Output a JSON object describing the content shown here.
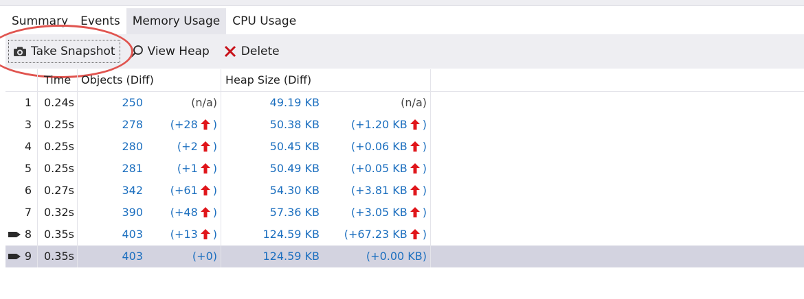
{
  "tabs": [
    "Summary",
    "Events",
    "Memory Usage",
    "CPU Usage"
  ],
  "toolbar": {
    "take_snapshot": "Take Snapshot",
    "view_heap": "View Heap",
    "delete": "Delete"
  },
  "columns": {
    "time": "Time",
    "objects": "Objects (Diff)",
    "heap": "Heap Size (Diff)"
  },
  "rows": [
    {
      "id": "1",
      "time": "0.24s",
      "objects": "250",
      "obj_diff": "(n/a)",
      "heap": "49.19 KB",
      "heap_diff": "(n/a)",
      "marker": false,
      "arrow": false
    },
    {
      "id": "3",
      "time": "0.25s",
      "objects": "278",
      "obj_diff": "(+28",
      "heap": "50.38 KB",
      "heap_diff": "(+1.20 KB",
      "marker": false,
      "arrow": true
    },
    {
      "id": "4",
      "time": "0.25s",
      "objects": "280",
      "obj_diff": "(+2",
      "heap": "50.45 KB",
      "heap_diff": "(+0.06 KB",
      "marker": false,
      "arrow": true
    },
    {
      "id": "5",
      "time": "0.25s",
      "objects": "281",
      "obj_diff": "(+1",
      "heap": "50.49 KB",
      "heap_diff": "(+0.05 KB",
      "marker": false,
      "arrow": true
    },
    {
      "id": "6",
      "time": "0.27s",
      "objects": "342",
      "obj_diff": "(+61",
      "heap": "54.30 KB",
      "heap_diff": "(+3.81 KB",
      "marker": false,
      "arrow": true
    },
    {
      "id": "7",
      "time": "0.32s",
      "objects": "390",
      "obj_diff": "(+48",
      "heap": "57.36 KB",
      "heap_diff": "(+3.05 KB",
      "marker": false,
      "arrow": true
    },
    {
      "id": "8",
      "time": "0.35s",
      "objects": "403",
      "obj_diff": "(+13",
      "heap": "124.59 KB",
      "heap_diff": "(+67.23 KB",
      "marker": true,
      "arrow": true
    },
    {
      "id": "9",
      "time": "0.35s",
      "objects": "403",
      "obj_diff": "(+0)",
      "heap": "124.59 KB",
      "heap_diff": "(+0.00 KB)",
      "marker": true,
      "arrow": false,
      "selected": true
    }
  ],
  "colors": {
    "accent_blue": "#1c6fbf",
    "arrow_red": "#e0161b",
    "annotation_red": "#e0544f",
    "selected_row": "#d3d3e0"
  },
  "icons": {
    "take_snapshot": "camera-icon",
    "view_heap": "magnifier-icon",
    "delete": "red-x-icon",
    "row_marker": "marker-icon",
    "diff_increase": "up-arrow-icon"
  }
}
